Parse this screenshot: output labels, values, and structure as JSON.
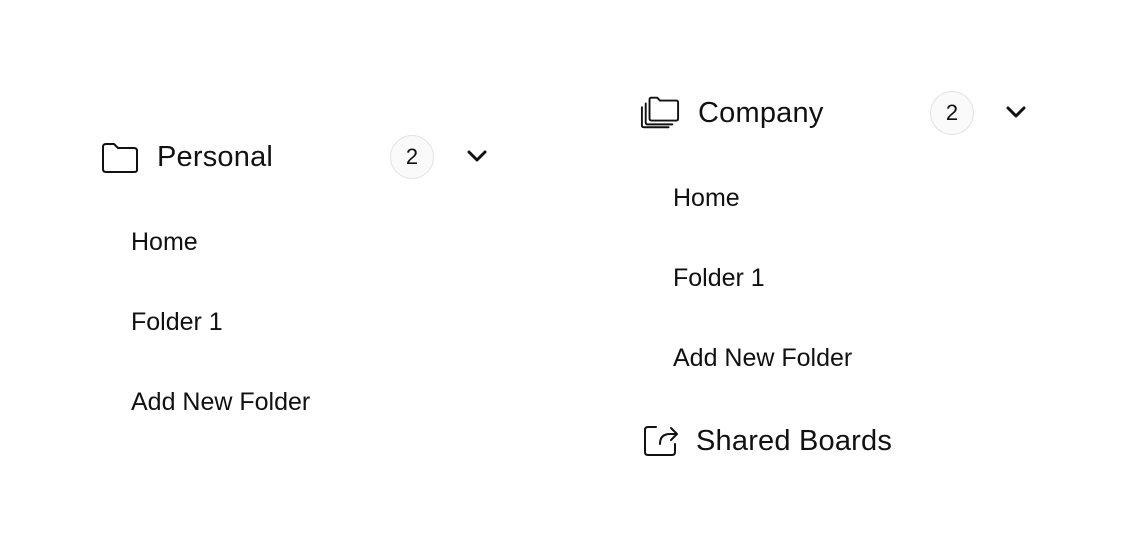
{
  "personal": {
    "label": "Personal",
    "count": "2",
    "icon": "folder-icon",
    "items": [
      {
        "label": "Home"
      },
      {
        "label": "Folder 1"
      },
      {
        "label": "Add New Folder"
      }
    ]
  },
  "company": {
    "label": "Company",
    "count": "2",
    "icon": "folders-stack-icon",
    "items": [
      {
        "label": "Home"
      },
      {
        "label": "Folder 1"
      },
      {
        "label": "Add New Folder"
      }
    ]
  },
  "shared": {
    "label": "Shared Boards",
    "icon": "share-icon"
  }
}
